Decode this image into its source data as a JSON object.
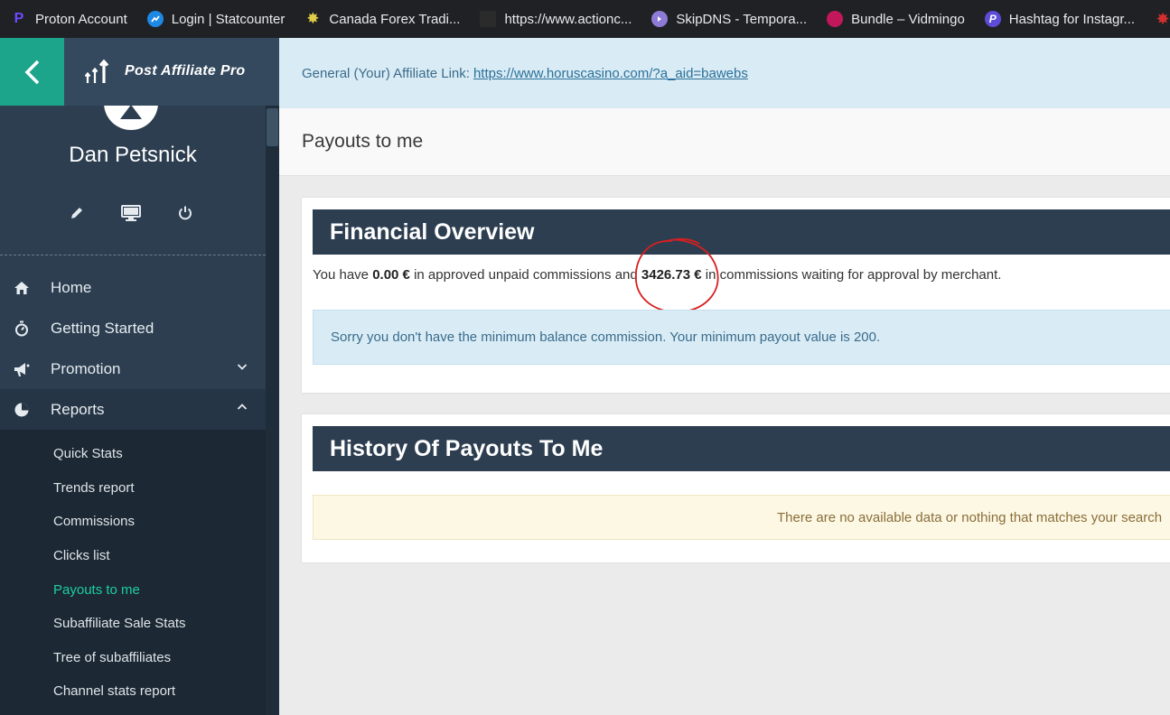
{
  "bookmarks": [
    {
      "label": "Proton Account",
      "icon": "proton-icon",
      "color": "#6d4aff",
      "glyph": "P"
    },
    {
      "label": "Login | Statcounter",
      "icon": "statcounter-icon",
      "color": "#1e88e5",
      "glyph": "S"
    },
    {
      "label": "Canada Forex Tradi...",
      "icon": "maple-leaf-icon",
      "color": "#d8c63a",
      "glyph": "✸"
    },
    {
      "label": "https://www.actionc...",
      "icon": "page-icon",
      "color": "#3a3a3a",
      "glyph": "▫"
    },
    {
      "label": "SkipDNS - Tempora...",
      "icon": "skipdns-icon",
      "color": "#8e7bd6",
      "glyph": "◐"
    },
    {
      "label": "Bundle – Vidmingo",
      "icon": "vidmingo-icon",
      "color": "#c2185b",
      "glyph": "◔"
    },
    {
      "label": "Hashtag for Instagr...",
      "icon": "hashtag-icon",
      "color": "#5c4cd9",
      "glyph": "P"
    }
  ],
  "brand": {
    "name": "Post Affiliate Pro",
    "accent": "#1ca58b"
  },
  "user": {
    "name": "Dan Petsnick"
  },
  "nav": {
    "home": "Home",
    "getting_started": "Getting Started",
    "promotion": "Promotion",
    "reports": "Reports",
    "sub": [
      {
        "label": "Quick Stats"
      },
      {
        "label": "Trends report"
      },
      {
        "label": "Commissions"
      },
      {
        "label": "Clicks list"
      },
      {
        "label": "Payouts to me"
      },
      {
        "label": "Subaffiliate Sale Stats"
      },
      {
        "label": "Tree of subaffiliates"
      },
      {
        "label": "Channel stats report"
      }
    ]
  },
  "affiliate": {
    "label": "General (Your) Affiliate Link:",
    "url": "https://www.horuscasino.com/?a_aid=bawebs"
  },
  "page_title": "Payouts to me",
  "financial": {
    "title": "Financial Overview",
    "text_1": "You have ",
    "approved": "0.00 €",
    "text_2": " in approved unpaid commissions and ",
    "waiting": "3426.73 €",
    "text_3": " in commissions waiting for approval by merchant.",
    "notice": "Sorry you don't have the minimum balance commission. Your minimum payout value is 200."
  },
  "history": {
    "title": "History Of Payouts To Me",
    "empty": "There are no available data or nothing that matches your search"
  }
}
